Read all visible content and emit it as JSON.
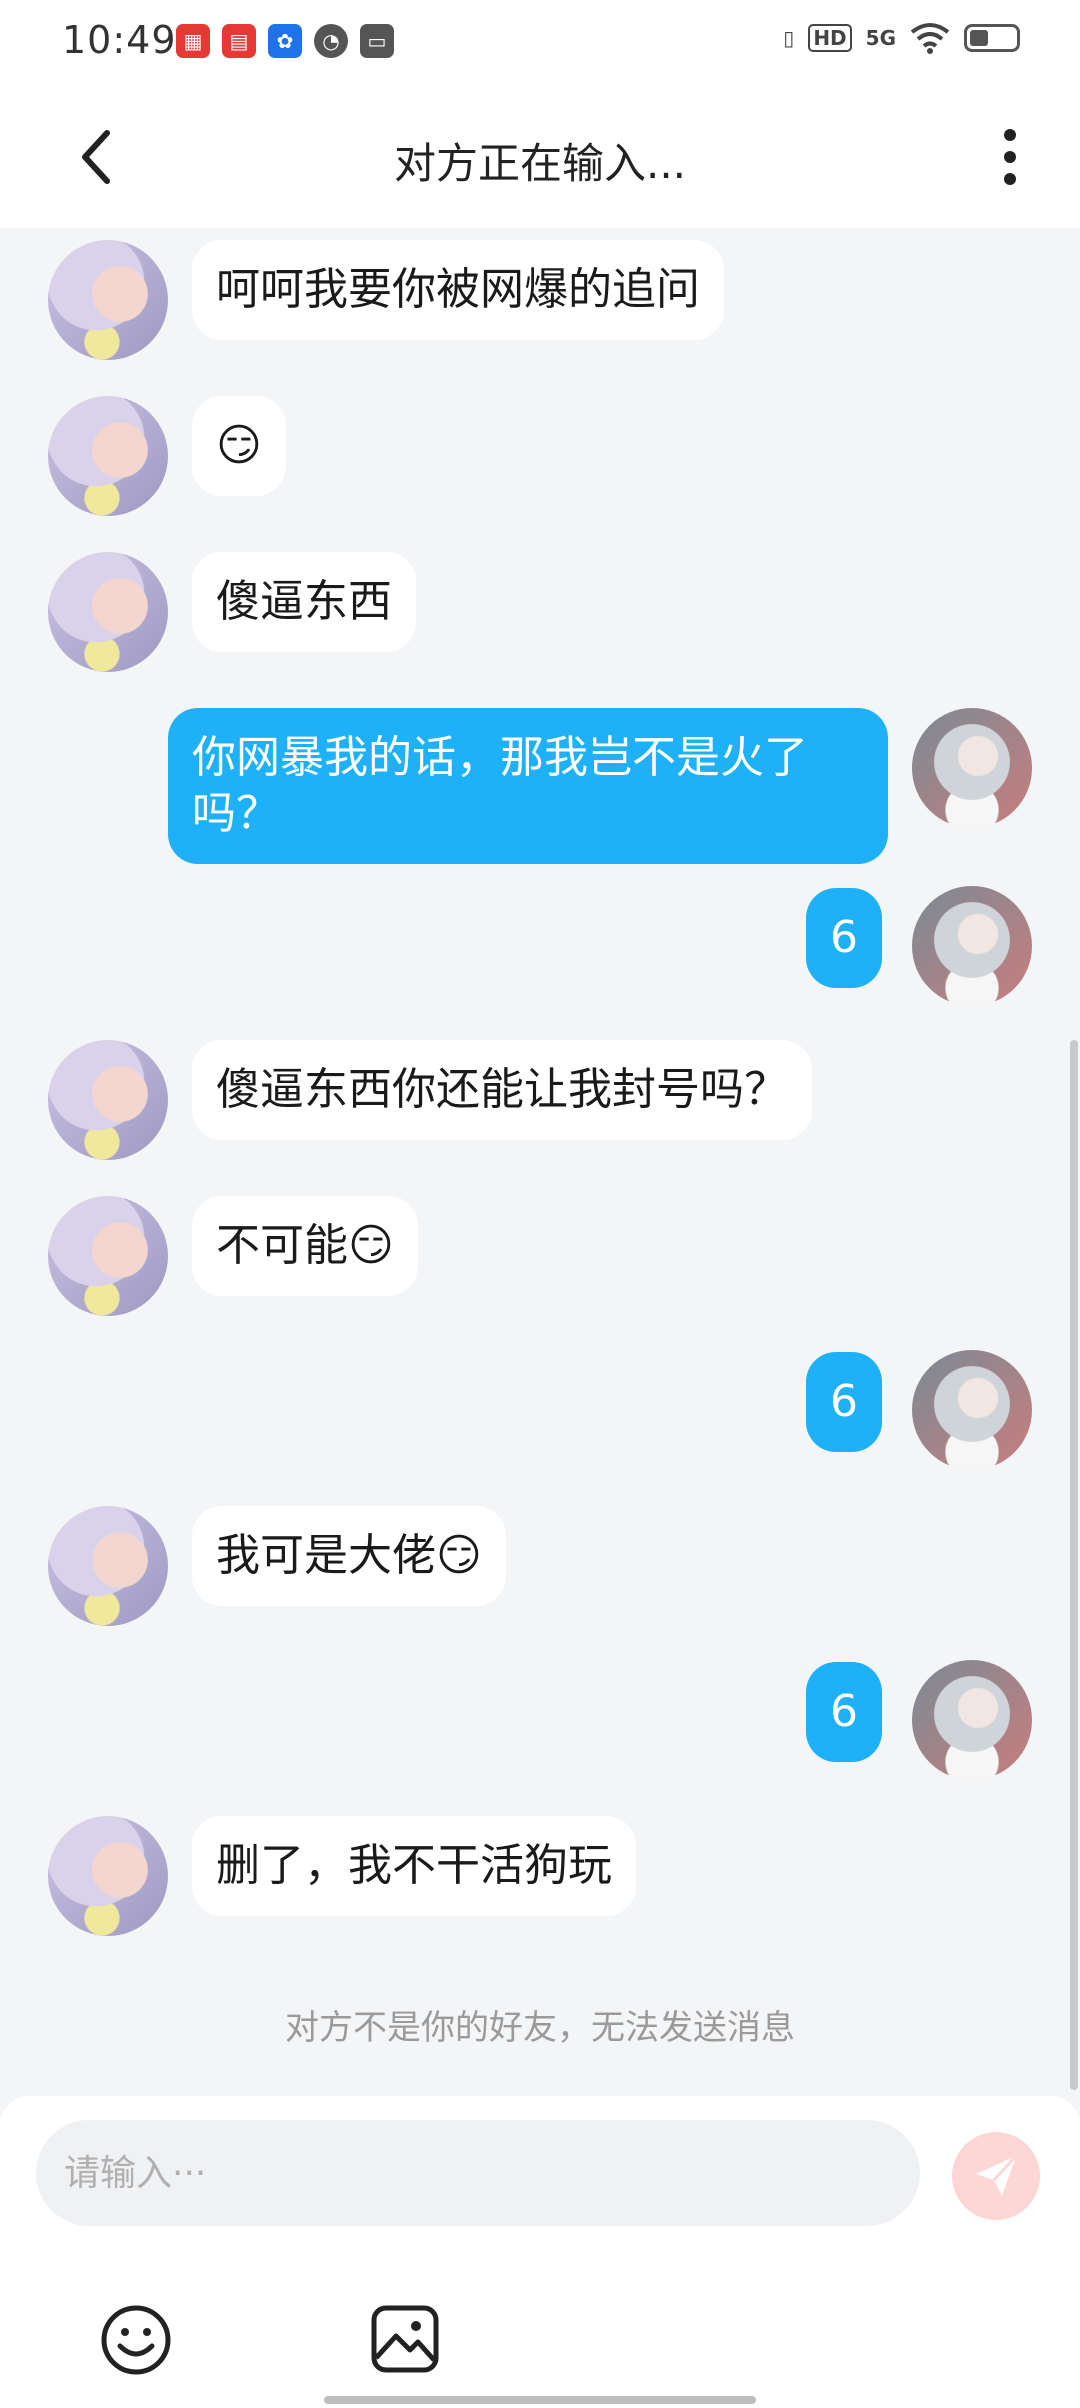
{
  "status_bar": {
    "time": "10:49",
    "indicators": [
      "HD",
      "5G"
    ]
  },
  "header": {
    "title": "对方正在输入..."
  },
  "messages": [
    {
      "side": "other",
      "text": "呵呵我要你被网爆的追问"
    },
    {
      "side": "other",
      "text": "😏"
    },
    {
      "side": "other",
      "text": "傻逼东西"
    },
    {
      "side": "me",
      "text": "你网暴我的话，那我岂不是火了吗？"
    },
    {
      "side": "me",
      "text": "6"
    },
    {
      "side": "other",
      "text": "傻逼东西你还能让我封号吗？"
    },
    {
      "side": "other",
      "text": "不可能😏"
    },
    {
      "side": "me",
      "text": "6"
    },
    {
      "side": "other",
      "text": "我可是大佬😏"
    },
    {
      "side": "me",
      "text": "6"
    },
    {
      "side": "other",
      "text": " 删了，我不干活狗玩"
    }
  ],
  "notice": "对方不是你的好友，无法发送消息",
  "input": {
    "placeholder": "请输入···"
  },
  "colors": {
    "my_bubble": "#1eb1f7",
    "other_bubble": "#ffffff",
    "send_disabled": "#ffd6d6"
  }
}
